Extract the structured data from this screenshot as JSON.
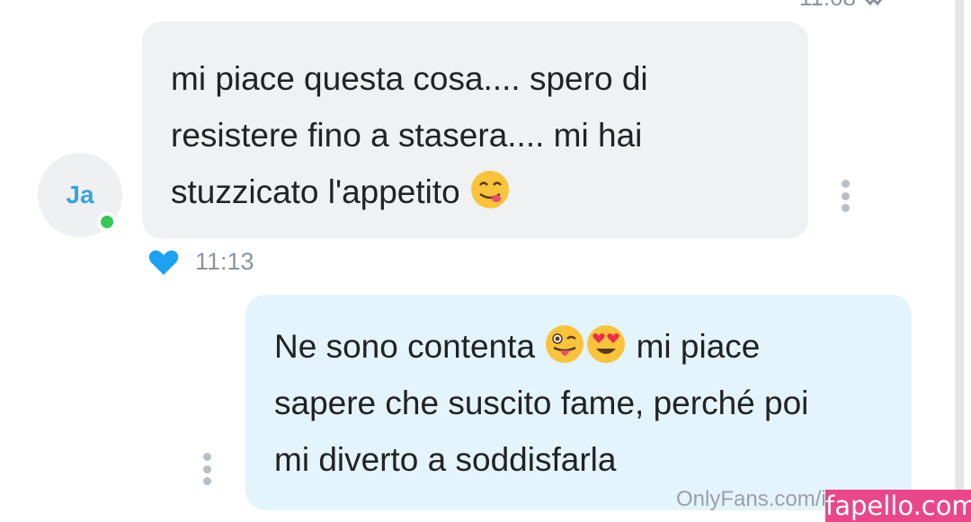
{
  "header": {
    "previous_time": "11:08"
  },
  "incoming": {
    "avatar_initials": "Ja",
    "text_line1": "mi piace questa cosa.... spero di",
    "text_line2": "resistere fino a stasera.... mi hai",
    "text_line3": "stuzzicato l'appetito",
    "time": "11:13",
    "liked": true,
    "emoji": "yum-face-icon"
  },
  "outgoing": {
    "text_line1_a": "Ne sono contenta",
    "text_line1_b": "mi piace",
    "text_line2": "sapere che suscito fame, perché poi",
    "text_line3": "mi diverto a soddisfarla",
    "emojis": [
      "winking-tongue-face-icon",
      "heart-eyes-face-icon"
    ]
  },
  "watermark": {
    "text": "OnlyFans.com/i",
    "brand": "fapello.com"
  },
  "colors": {
    "incoming_bubble": "#f0f1f3",
    "outgoing_bubble": "#e4f4fd",
    "heart": "#1da1f2",
    "online": "#35c759",
    "brand": "#e8488a"
  }
}
